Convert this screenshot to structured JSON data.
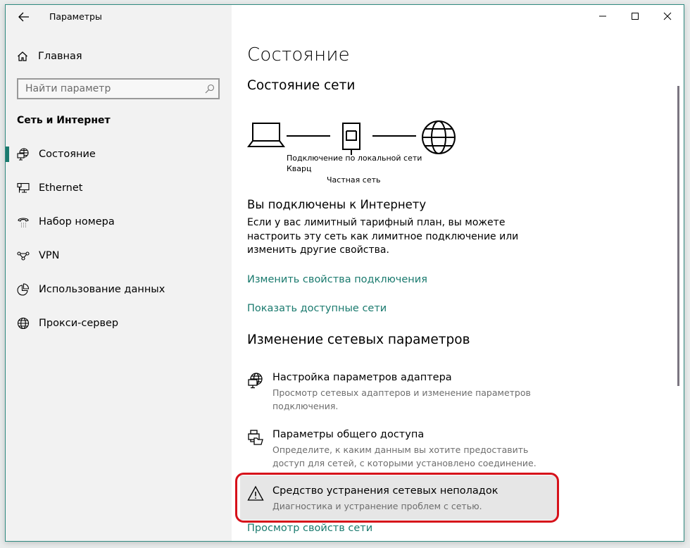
{
  "window": {
    "title": "Параметры",
    "controls": {
      "minimize": "minimize-icon",
      "maximize": "maximize-icon",
      "close": "close-icon"
    }
  },
  "sidebar": {
    "back_icon": "arrow-left-icon",
    "home_label": "Главная",
    "search": {
      "placeholder": "Найти параметр",
      "value": "",
      "icon": "search-icon"
    },
    "section_title": "Сеть и Интернет",
    "items": [
      {
        "label": "Состояние",
        "icon": "network-status-icon",
        "active": true
      },
      {
        "label": "Ethernet",
        "icon": "ethernet-icon",
        "active": false
      },
      {
        "label": "Набор номера",
        "icon": "dialup-phone-icon",
        "active": false
      },
      {
        "label": "VPN",
        "icon": "vpn-icon",
        "active": false
      },
      {
        "label": "Использование данных",
        "icon": "data-usage-icon",
        "active": false
      },
      {
        "label": "Прокси-сервер",
        "icon": "globe-icon",
        "active": false
      }
    ]
  },
  "main": {
    "page_title": "Состояние",
    "network_status": {
      "heading": "Состояние сети",
      "diagram": {
        "icons": [
          "laptop-icon",
          "ethernet-port-icon",
          "globe-icon"
        ],
        "connection_name": "Подключение по локальной сети",
        "network_name": "Кварц",
        "network_type": "Частная сеть"
      },
      "connected_title": "Вы подключены к Интернету",
      "connected_desc": "Если у вас лимитный тарифный план, вы можете настроить эту сеть как лимитное подключение или изменить другие свойства.",
      "links": {
        "change_props": "Изменить свойства подключения",
        "show_networks": "Показать доступные сети"
      }
    },
    "change_settings": {
      "heading": "Изменение сетевых параметров",
      "options": [
        {
          "title": "Настройка параметров адаптера",
          "desc": "Просмотр сетевых адаптеров и изменение параметров подключения.",
          "icon": "adapter-icon"
        },
        {
          "title": "Параметры общего доступа",
          "desc": "Определите, к каким данным вы хотите предоставить доступ для сетей, с которыми установлено соединение.",
          "icon": "sharing-icon"
        },
        {
          "title": "Средство устранения сетевых неполадок",
          "desc": "Диагностика и устранение проблем с сетью.",
          "icon": "warning-icon",
          "highlighted": true
        }
      ],
      "view_props_link": "Просмотр свойств сети"
    }
  },
  "colors": {
    "accent": "#1a7a6e",
    "highlight": "#d6111a",
    "sidebar_bg": "#f2f2f2"
  }
}
